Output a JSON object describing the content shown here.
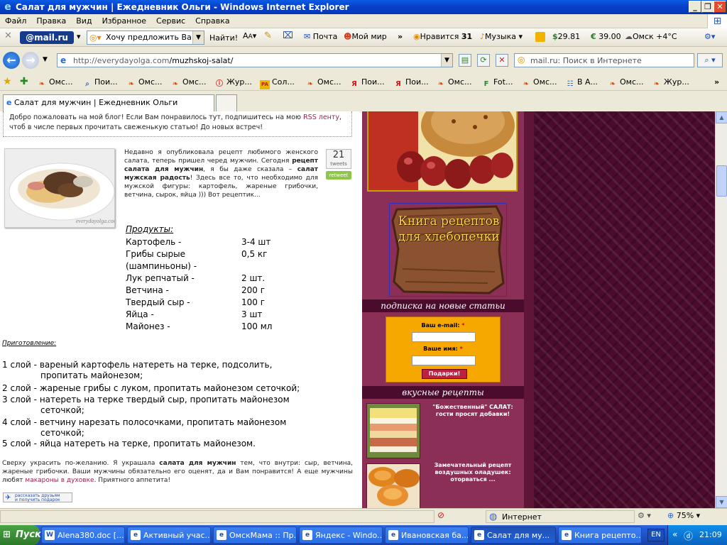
{
  "window": {
    "title": "Салат для мужчин | Ежедневник Ольги - Windows Internet Explorer"
  },
  "menu": [
    "Файл",
    "Правка",
    "Вид",
    "Избранное",
    "Сервис",
    "Справка"
  ],
  "mailbar": {
    "logo_text": "@mail.ru",
    "suggest_text": "Хочу предложить Ва",
    "find_label": "Найти!",
    "mail_label": "Почта",
    "myworld_label": "Мой мир",
    "likes_label": "Нравится",
    "likes_count": "31",
    "music_label": "Музыка",
    "usd": "29.81",
    "eur": "39.00",
    "weather": "Омск +4°C"
  },
  "address": {
    "url_prefix": "http://everydayolga.com",
    "url_path": "/muzhskoj-salat/",
    "search_placeholder": "mail.ru: Поиск в Интернете"
  },
  "favorites": [
    {
      "label": "Омс...",
      "icon": "map-pin"
    },
    {
      "label": "Пои...",
      "icon": "search-icon"
    },
    {
      "label": "Омс...",
      "icon": "map-pin"
    },
    {
      "label": "Омс...",
      "icon": "map-pin"
    },
    {
      "label": "Жур...",
      "icon": "info"
    },
    {
      "label": "Сол...",
      "icon": "papa"
    },
    {
      "label": "Омс...",
      "icon": "map-pin"
    },
    {
      "label": "Пои...",
      "icon": "yandex"
    },
    {
      "label": "Пои...",
      "icon": "yandex"
    },
    {
      "label": "Омс...",
      "icon": "map-pin"
    },
    {
      "label": "Fot...",
      "icon": "fotki"
    },
    {
      "label": "Омс...",
      "icon": "map-pin"
    },
    {
      "label": "В А...",
      "icon": "group"
    },
    {
      "label": "Омс...",
      "icon": "map-pin"
    },
    {
      "label": "Жур...",
      "icon": "map-pin"
    }
  ],
  "tab": {
    "title": "Салат для мужчин | Ежедневник Ольги"
  },
  "page": {
    "welcome": "Добро пожаловать на мой блог! Если Вам понравилось тут, подпишитесь на мою",
    "welcome_link": "RSS ленту",
    "welcome_end": ", чтоб в числе первых прочитать свеженькую статью! До новых встреч!",
    "photo_watermark": "everydayolga.com",
    "tweets_count": "21",
    "tweets_label": "tweets",
    "retweet_label": "retweet",
    "intro_1": "Недавно я опубликовала рецепт любимого женского салата, теперь пришел черед мужчин. Сегодня",
    "intro_bold_1": "рецепт салата для мужчин",
    "intro_2": ", я бы даже сказала –",
    "intro_bold_2": "салат мужская радость",
    "intro_3": "! Здесь все то, что необходимо для мужской фигуры: картофель, жареные грибочки, ветчина, сырок, яйца ))) Вот рецептик...",
    "products_title": "Продукты:",
    "ingredients": [
      {
        "name": "Картофель -",
        "qty": "3-4 шт"
      },
      {
        "name": "Грибы сырые (шампиньоны) -",
        "qty": "0,5 кг"
      },
      {
        "name": "Лук репчатый -",
        "qty": "2 шт."
      },
      {
        "name": "Ветчина -",
        "qty": "200 г"
      },
      {
        "name": "Твердый сыр -",
        "qty": "100 г"
      },
      {
        "name": "Яйца -",
        "qty": "3 шт"
      },
      {
        "name": "Майонез -",
        "qty": "100 мл"
      }
    ],
    "prep_title": "Приготовление:",
    "steps": [
      {
        "a": "1 слой - вареный картофель натереть на терке, подсолить,",
        "b": "пропитать майонезом;"
      },
      {
        "a": "2 слой - жареные грибы с луком, пропитать майонезом сеточкой;",
        "b": ""
      },
      {
        "a": "3 слой - натереть на терке твердый сыр, пропитать майонезом",
        "b": "сеточкой;"
      },
      {
        "a": "4 слой - ветчину нарезать полосочками, пропитать майонезом",
        "b": "сеточкой;"
      },
      {
        "a": "5 слой - яйца натереть на терке, пропитать майонезом.",
        "b": ""
      }
    ],
    "outro_1": "Сверху украсить по-желанию. Я украшала",
    "outro_bold": "салата для мужчин",
    "outro_2": "тем, что внутри: сыр, ветчина, жареные грибочки. Ваши мужчины обязательно его оценят, да и Вам понравится! А еще мужчины любят",
    "outro_link": "макароны в духовке",
    "outro_3": ". Приятного аппетита!",
    "share_label_1": "рассказать друзьям",
    "share_label_2": "и получить подарок"
  },
  "sidebar": {
    "book_title": "Книга рецептов для хлебопечки",
    "subscribe_header": "подписка на новые статьи",
    "email_label": "Ваш e-mail:",
    "name_label": "Ваше имя:",
    "required_mark": "*",
    "submit_label": "Подарки!",
    "recipes_header": "вкусные рецепты",
    "recipe_1": "\"Божественный\" САЛАТ: гости просят добавки!",
    "recipe_2": "Замечательный рецепт воздушных оладушек: оторваться ..."
  },
  "status": {
    "zone": "Интернет",
    "zoom": "75%"
  },
  "taskbar": {
    "start": "Пуск",
    "tasks": [
      {
        "label": "Alena380.doc [...",
        "icon": "W"
      },
      {
        "label": "Активный учас...",
        "icon": "e"
      },
      {
        "label": "ОмскМама :: Пр...",
        "icon": "e"
      },
      {
        "label": "Яндекс - Windo...",
        "icon": "e"
      },
      {
        "label": "Ивановская ба...",
        "icon": "e"
      },
      {
        "label": "Салат для му...",
        "icon": "e"
      },
      {
        "label": "Книга рецепто...",
        "icon": "e"
      }
    ],
    "lang": "EN",
    "clock": "21:09"
  },
  "colors": {
    "titlebar": "#0a5be6",
    "sidebar": "#8c2f57",
    "background": "#4c0d2e",
    "form_bg": "#f7a800",
    "link": "#a0204f"
  }
}
